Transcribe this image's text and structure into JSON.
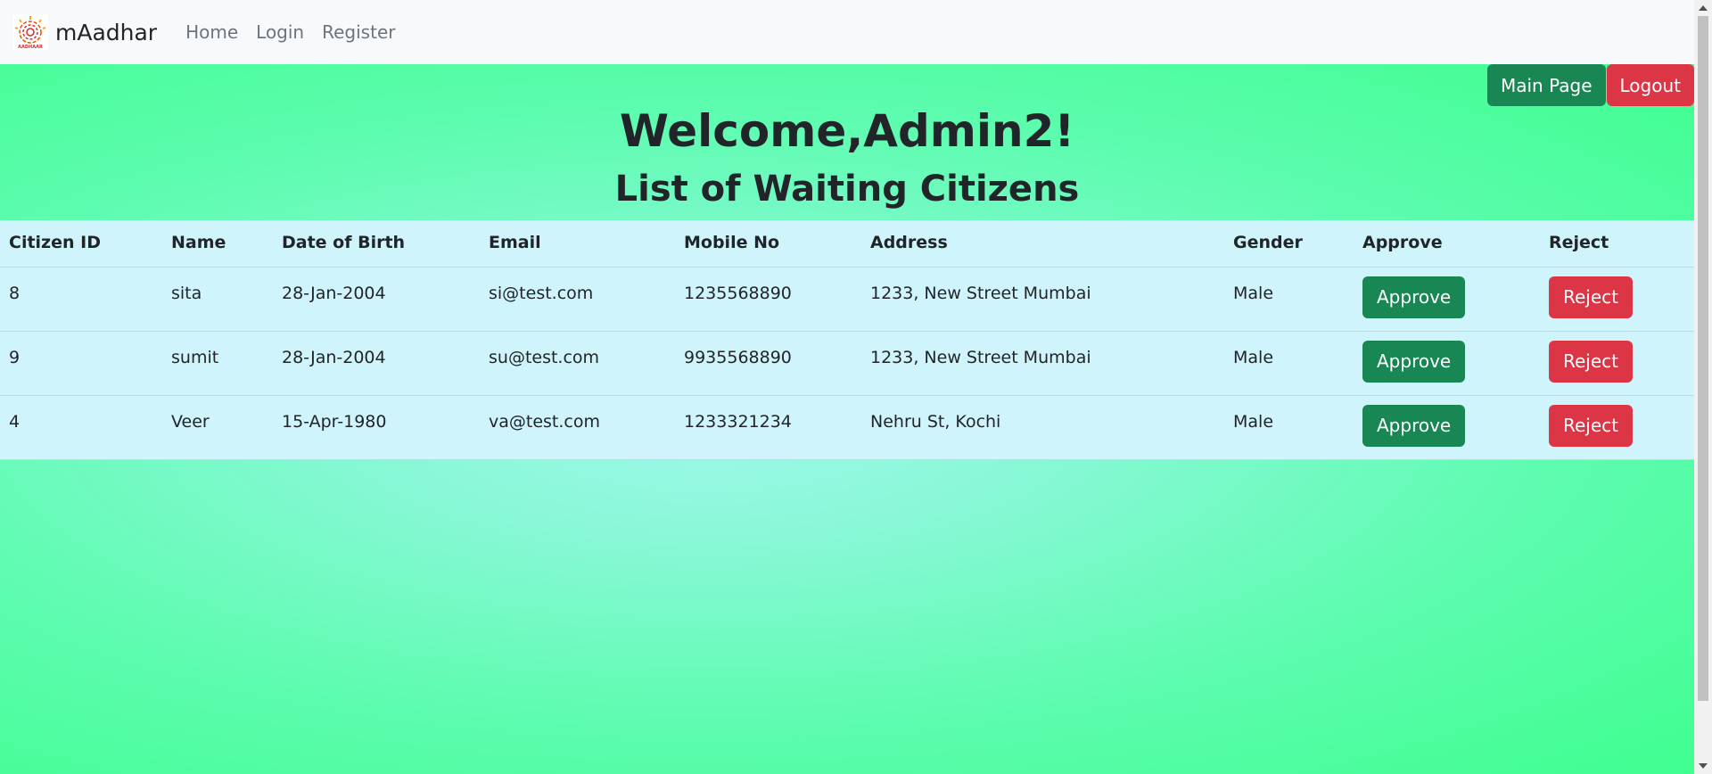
{
  "navbar": {
    "brand": "mAadhar",
    "logo_text": "AADHAAR",
    "links": [
      "Home",
      "Login",
      "Register"
    ]
  },
  "top_buttons": {
    "main_page": "Main Page",
    "logout": "Logout"
  },
  "welcome": "Welcome,Admin2!",
  "subtitle": "List of Waiting Citizens",
  "table": {
    "headers": [
      "Citizen ID",
      "Name",
      "Date of Birth",
      "Email",
      "Mobile No",
      "Address",
      "Gender",
      "Approve",
      "Reject"
    ],
    "rows": [
      {
        "id": "8",
        "name": "sita",
        "dob": "28-Jan-2004",
        "email": "si@test.com",
        "mobile": "1235568890",
        "address": "1233, New Street Mumbai",
        "gender": "Male",
        "approve": "Approve",
        "reject": "Reject"
      },
      {
        "id": "9",
        "name": "sumit",
        "dob": "28-Jan-2004",
        "email": "su@test.com",
        "mobile": "9935568890",
        "address": "1233, New Street Mumbai",
        "gender": "Male",
        "approve": "Approve",
        "reject": "Reject"
      },
      {
        "id": "4",
        "name": "Veer",
        "dob": "15-Apr-1980",
        "email": "va@test.com",
        "mobile": "1233321234",
        "address": "Nehru St, Kochi",
        "gender": "Male",
        "approve": "Approve",
        "reject": "Reject"
      }
    ]
  },
  "colors": {
    "approve": "#198754",
    "reject": "#dc3545",
    "table_bg": "#cff4fc",
    "page_bg": "#3ffe8f"
  }
}
